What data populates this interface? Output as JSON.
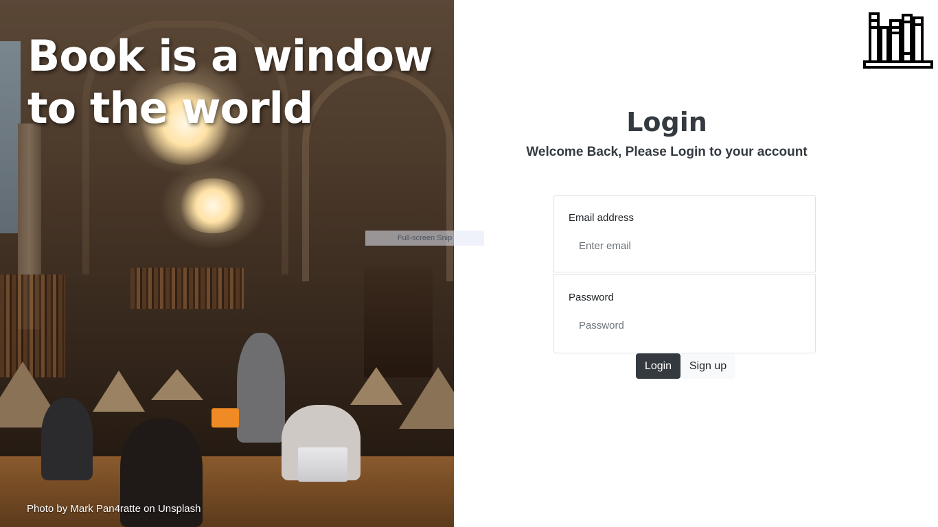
{
  "hero": {
    "title_line1": "Book is a window",
    "title_line2": "to the world",
    "photo_credit": "Photo by Mark Pan4ratte on Unsplash"
  },
  "overlay": {
    "snip_label": "Full-screen Snip"
  },
  "logo": {
    "icon": "bookshelf-icon"
  },
  "login": {
    "title": "Login",
    "subtitle": "Welcome Back, Please Login to your account",
    "email": {
      "label": "Email address",
      "placeholder": "Enter email",
      "value": ""
    },
    "password": {
      "label": "Password",
      "placeholder": "Password",
      "value": ""
    },
    "login_button": "Login",
    "signup_button": "Sign up"
  },
  "colors": {
    "dark": "#343a40",
    "light_button": "#f8f9fa",
    "border": "#dee2e6",
    "placeholder": "#6c757d"
  }
}
